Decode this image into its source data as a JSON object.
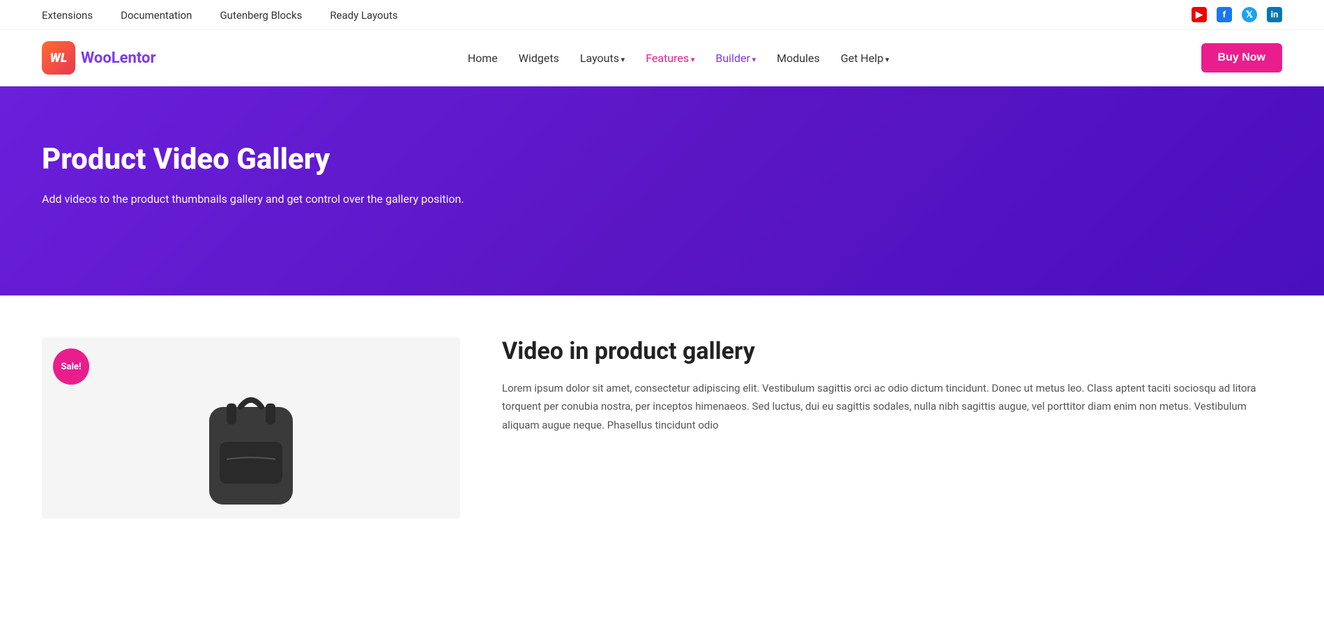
{
  "top_bar": {
    "nav_items": [
      {
        "label": "Extensions",
        "href": "#"
      },
      {
        "label": "Documentation",
        "href": "#"
      },
      {
        "label": "Gutenberg Blocks",
        "href": "#"
      },
      {
        "label": "Ready Layouts",
        "href": "#"
      }
    ],
    "social_icons": [
      {
        "name": "YouTube",
        "type": "youtube"
      },
      {
        "name": "Facebook",
        "type": "facebook"
      },
      {
        "name": "Twitter",
        "type": "twitter"
      },
      {
        "name": "LinkedIn",
        "type": "linkedin"
      }
    ]
  },
  "main_nav": {
    "logo_initials": "WL",
    "logo_brand_part1": "Woo",
    "logo_brand_part2": "Lentor",
    "links": [
      {
        "label": "Home",
        "href": "#",
        "style": "normal",
        "has_arrow": false
      },
      {
        "label": "Widgets",
        "href": "#",
        "style": "normal",
        "has_arrow": false
      },
      {
        "label": "Layouts",
        "href": "#",
        "style": "normal",
        "has_arrow": true
      },
      {
        "label": "Features",
        "href": "#",
        "style": "pink",
        "has_arrow": true
      },
      {
        "label": "Builder",
        "href": "#",
        "style": "purple",
        "has_arrow": true
      },
      {
        "label": "Modules",
        "href": "#",
        "style": "normal",
        "has_arrow": false
      },
      {
        "label": "Get Help",
        "href": "#",
        "style": "normal",
        "has_arrow": true
      }
    ],
    "buy_button_label": "Buy Now"
  },
  "hero": {
    "title": "Product Video Gallery",
    "description": "Add videos to the product thumbnails gallery and get control over the gallery position."
  },
  "content": {
    "product_section_title": "Video in product gallery",
    "sale_badge_text": "Sale!",
    "product_description": "Lorem ipsum dolor sit amet, consectetur adipiscing elit. Vestibulum sagittis orci ac odio dictum tincidunt. Donec ut metus leo. Class aptent taciti sociosqu ad litora torquent per conubia nostra, per inceptos himenaeos. Sed luctus, dui eu sagittis sodales, nulla nibh sagittis augue, vel porttitor diam enim non metus. Vestibulum aliquam augue neque. Phasellus tincidunt odio"
  }
}
